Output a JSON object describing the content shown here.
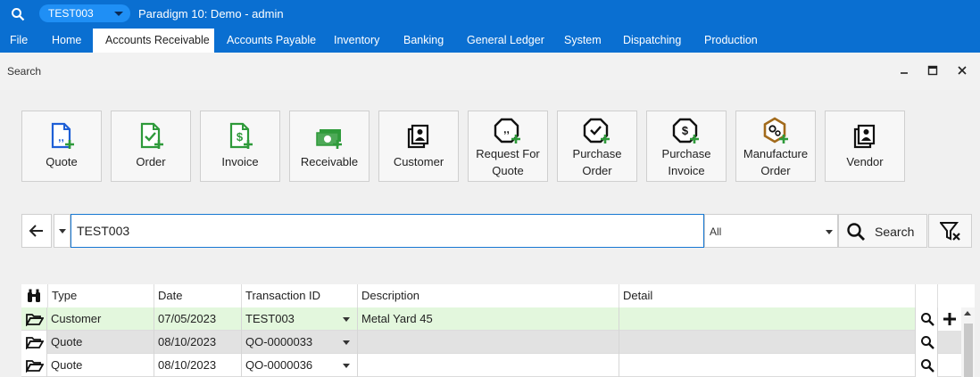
{
  "titlebar": {
    "search_icon": "search-icon",
    "company": "TEST003",
    "title": "Paradigm 10: Demo - admin"
  },
  "menu": {
    "items": [
      {
        "label": "File"
      },
      {
        "label": "Home"
      },
      {
        "label": "Accounts Receivable",
        "active": true
      },
      {
        "label": "Accounts Payable"
      },
      {
        "label": "Inventory"
      },
      {
        "label": "Banking"
      },
      {
        "label": "General Ledger"
      },
      {
        "label": "System"
      },
      {
        "label": "Dispatching"
      },
      {
        "label": "Production"
      }
    ]
  },
  "panel": {
    "title": "Search"
  },
  "tiles": [
    {
      "label": "Quote",
      "icon": "quote-add-icon"
    },
    {
      "label": "Order",
      "icon": "order-add-icon"
    },
    {
      "label": "Invoice",
      "icon": "invoice-add-icon"
    },
    {
      "label": "Receivable",
      "icon": "receivable-add-icon"
    },
    {
      "label": "Customer",
      "icon": "customer-add-icon"
    },
    {
      "label": "Request For Quote",
      "line1": "Request For",
      "line2": "Quote",
      "icon": "rfq-add-icon"
    },
    {
      "label": "Purchase Order",
      "line1": "Purchase",
      "line2": "Order",
      "icon": "purchase-order-add-icon"
    },
    {
      "label": "Purchase Invoice",
      "line1": "Purchase",
      "line2": "Invoice",
      "icon": "purchase-invoice-add-icon"
    },
    {
      "label": "Manufacture Order",
      "line1": "Manufacture",
      "line2": "Order",
      "icon": "manufacture-order-add-icon"
    },
    {
      "label": "Vendor",
      "icon": "vendor-add-icon"
    }
  ],
  "search": {
    "value": "TEST003",
    "scope": "All",
    "button": "Search"
  },
  "table": {
    "columns": [
      "Type",
      "Date",
      "Transaction ID",
      "Description",
      "Detail"
    ],
    "rows": [
      {
        "type": "Customer",
        "date": "07/05/2023",
        "transaction_id": "TEST003",
        "description": "Metal Yard 45",
        "detail": ""
      },
      {
        "type": "Quote",
        "date": "08/10/2023",
        "transaction_id": "QO-0000033",
        "description": "",
        "detail": ""
      },
      {
        "type": "Quote",
        "date": "08/10/2023",
        "transaction_id": "QO-0000036",
        "description": "",
        "detail": ""
      }
    ]
  },
  "colors": {
    "title_bar": "#0a6fd1",
    "company_pill": "#1f8ff5",
    "add_badge": "#2e9a3a",
    "selected_row": "#e3f7dd",
    "alt_row": "#e2e2e2",
    "input_border": "#1677d2",
    "manufacture_icon": "#a26a1b"
  }
}
